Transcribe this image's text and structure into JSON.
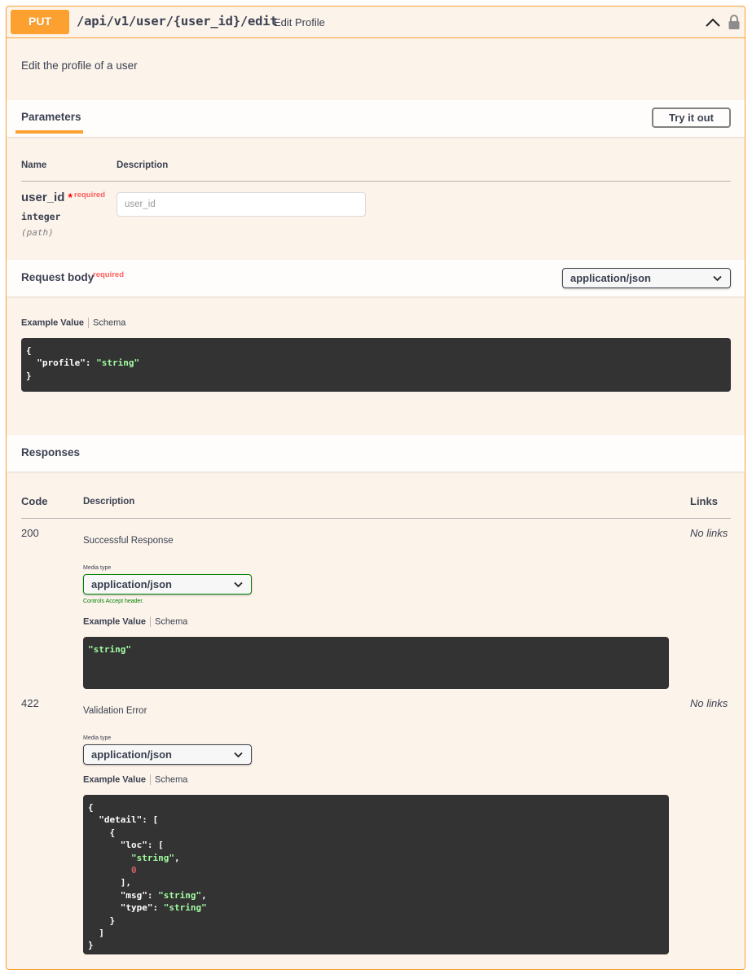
{
  "operation": {
    "method": "PUT",
    "path": "/api/v1/user/{user_id}/edit",
    "summary": "Edit Profile",
    "description": "Edit the profile of a user"
  },
  "parameters": {
    "tab_label": "Parameters",
    "try_it_out_label": "Try it out",
    "col_name": "Name",
    "col_description": "Description",
    "items": [
      {
        "name": "user_id",
        "star": "*",
        "required_label": "required",
        "type": "integer",
        "in": "(path)",
        "placeholder": "user_id",
        "value": ""
      }
    ]
  },
  "request_body": {
    "title": "Request body",
    "required_label": "required",
    "content_type": "application/json",
    "example_tab": "Example Value",
    "schema_tab": "Schema",
    "example_lines": [
      "{",
      "  \"profile\": \"string\"",
      "}"
    ]
  },
  "responses": {
    "title": "Responses",
    "col_code": "Code",
    "col_description": "Description",
    "col_links": "Links",
    "media_type_label": "Media type",
    "controls_note": "Controls Accept header.",
    "example_tab": "Example Value",
    "schema_tab": "Schema",
    "items": [
      {
        "code": "200",
        "description": "Successful Response",
        "media_type": "application/json",
        "links": "No links",
        "example": "\"string\""
      },
      {
        "code": "422",
        "description": "Validation Error",
        "media_type": "application/json",
        "links": "No links",
        "example_lines": [
          "{",
          "  \"detail\": [",
          "    {",
          "      \"loc\": [",
          "        \"string\",",
          "        0",
          "      ],",
          "      \"msg\": \"string\",",
          "      \"type\": \"string\"",
          "    }",
          "  ]",
          "}"
        ]
      }
    ]
  },
  "colors": {
    "put_accent": "#fca130",
    "block_background": "#fcf3ea",
    "code_background": "#333333",
    "string_green": "#a2fca2",
    "number_red": "#d36363",
    "required_red": "#ff6060"
  },
  "icons": [
    "chevron-up-icon",
    "lock-icon",
    "chevron-down-icon"
  ]
}
